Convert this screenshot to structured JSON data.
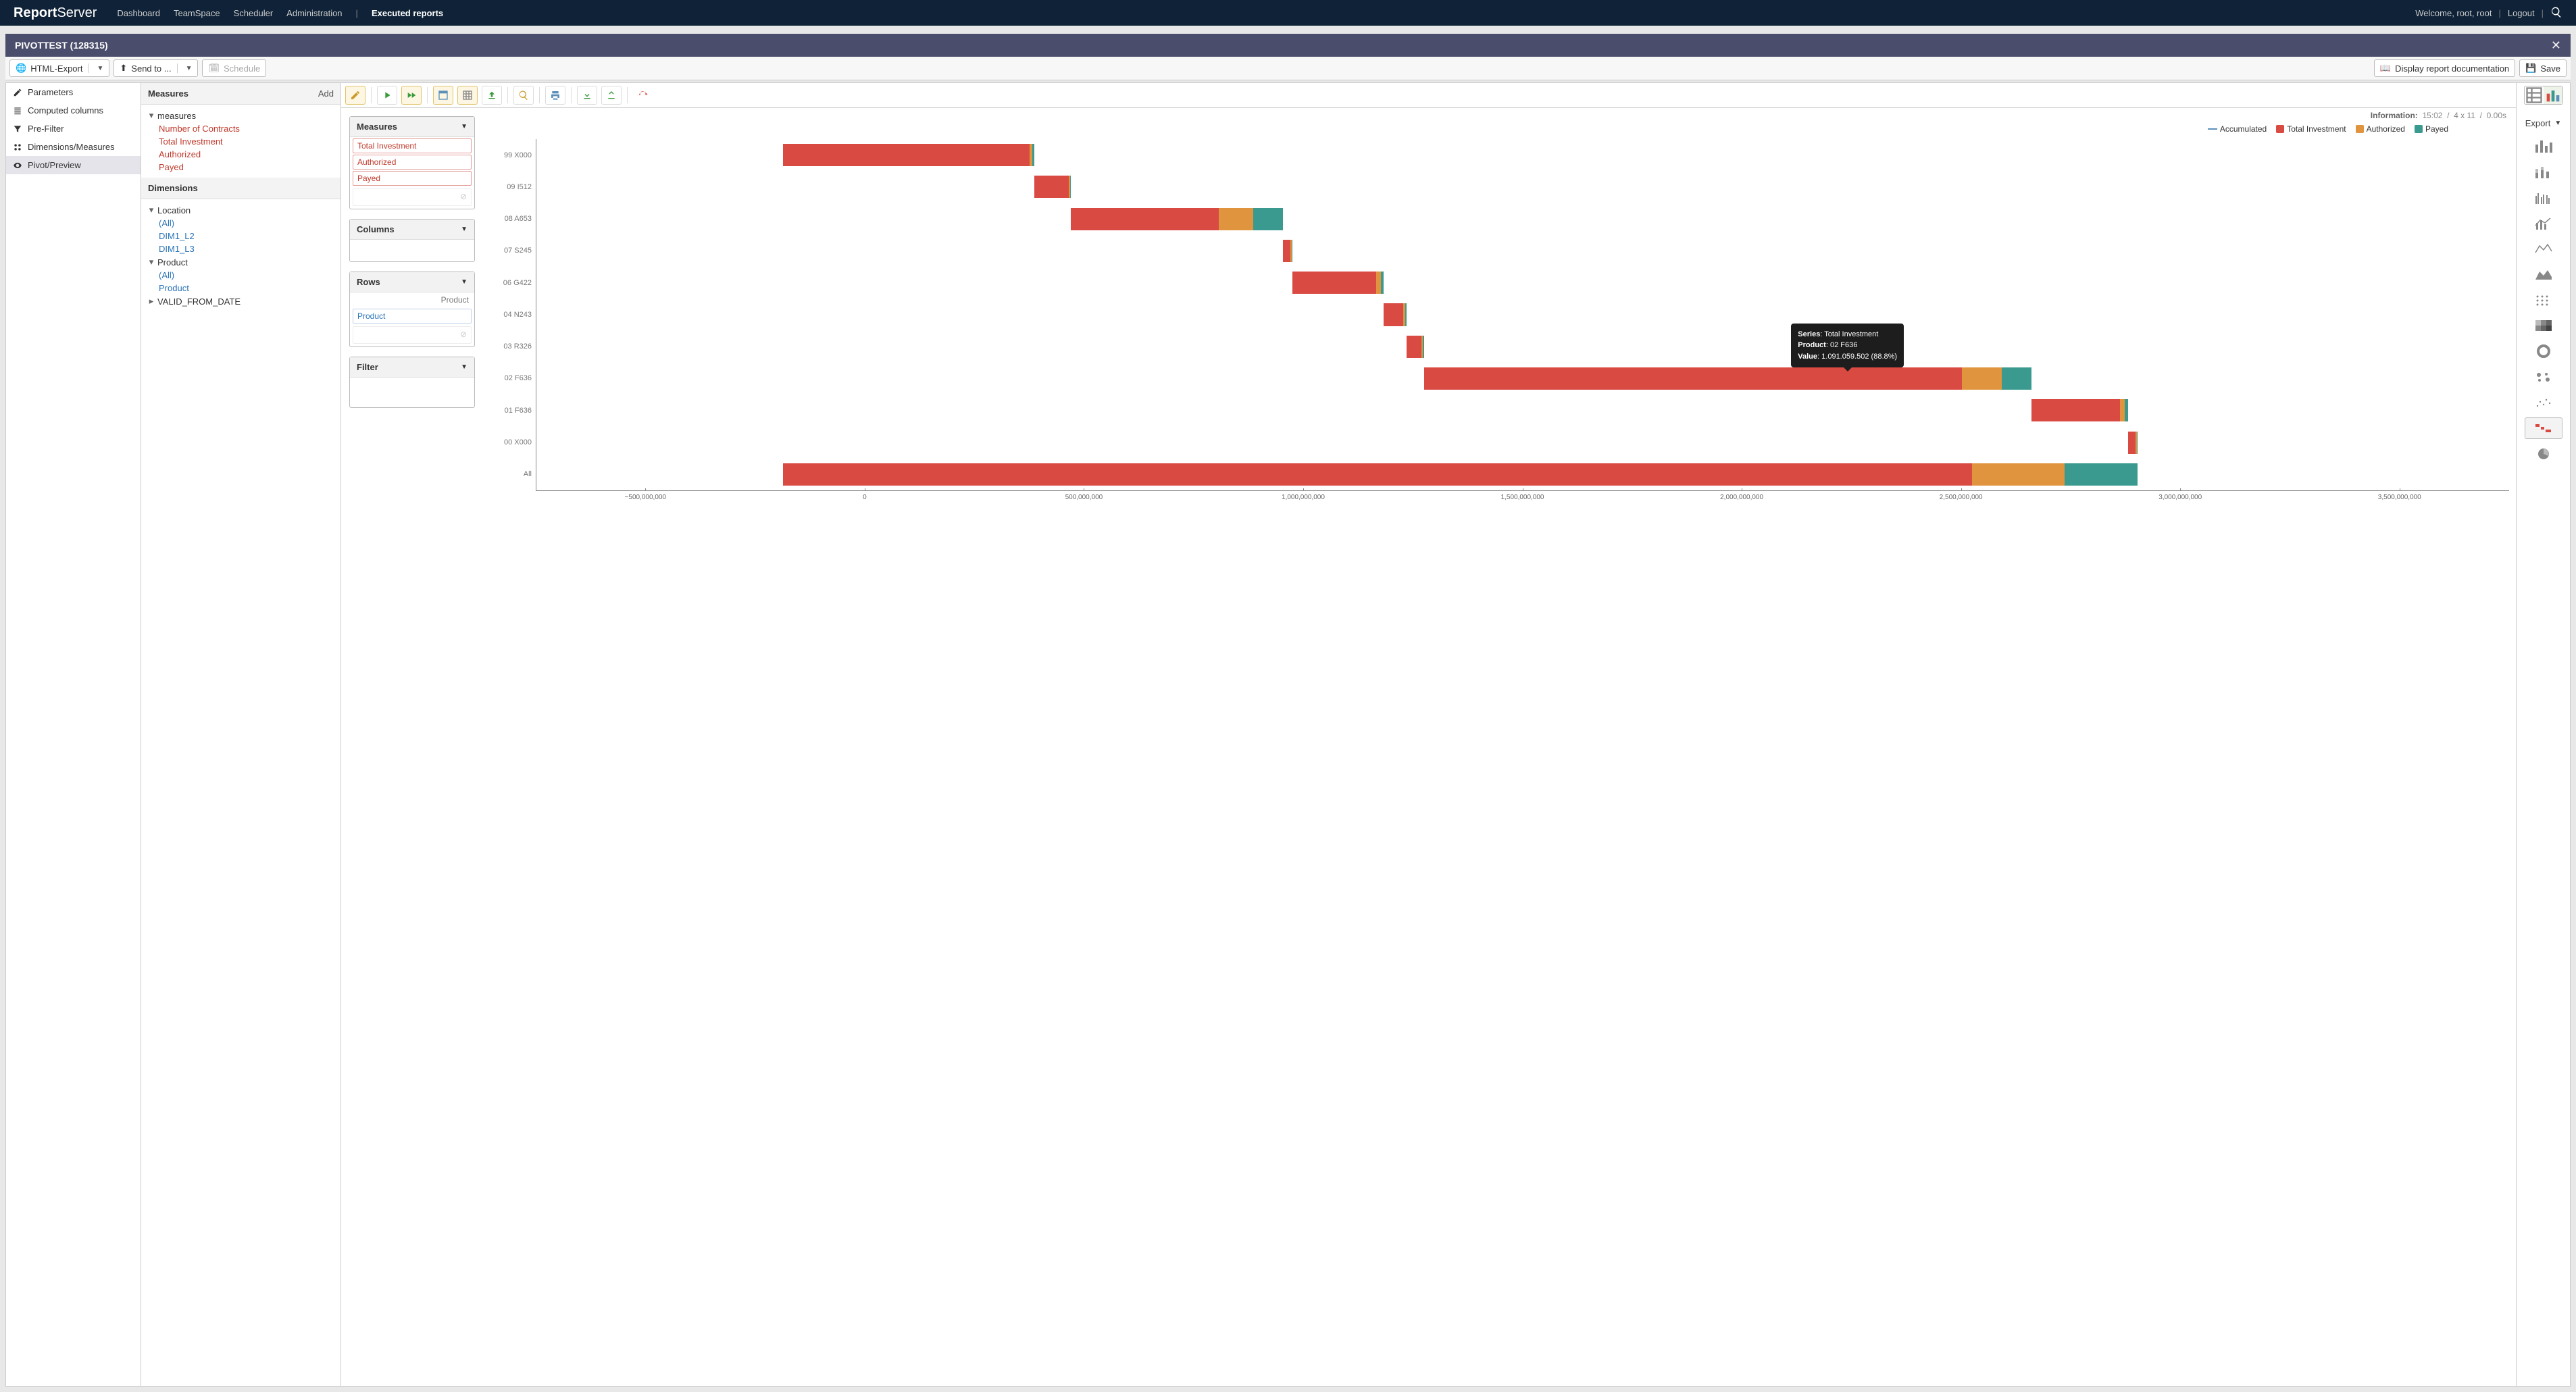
{
  "brand": {
    "bold": "Report",
    "light": "Server"
  },
  "topnav": {
    "dashboard": "Dashboard",
    "teamspace": "TeamSpace",
    "scheduler": "Scheduler",
    "admin": "Administration",
    "executed": "Executed reports"
  },
  "topright": {
    "welcome": "Welcome, root, root",
    "logout": "Logout"
  },
  "subbar": {
    "title": "PIVOTTEST (128315)"
  },
  "toolbar": {
    "html_export": "HTML-Export",
    "send_to": "Send to ...",
    "schedule": "Schedule",
    "display_doc": "Display report documentation",
    "save": "Save"
  },
  "leftnav": {
    "parameters": "Parameters",
    "computed": "Computed columns",
    "prefilter": "Pre-Filter",
    "dims": "Dimensions/Measures",
    "pivot": "Pivot/Preview"
  },
  "measures": {
    "hdr": "Measures",
    "add": "Add",
    "root": "measures",
    "items": [
      "Number of Contracts",
      "Total Investment",
      "Authorized",
      "Payed"
    ]
  },
  "dimensions": {
    "hdr": "Dimensions",
    "location": "Location",
    "loc_all": "(All)",
    "dim1l2": "DIM1_L2",
    "dim1l3": "DIM1_L3",
    "product": "Product",
    "prod_all": "(All)",
    "prod_item": "Product",
    "valid_from": "VALID_FROM_DATE"
  },
  "drop": {
    "measures": "Measures",
    "columns": "Columns",
    "rows": "Rows",
    "filter": "Filter",
    "rows_sub": "Product",
    "rows_chip": "Product",
    "m1": "Total Investment",
    "m2": "Authorized",
    "m3": "Payed"
  },
  "info": {
    "label": "Information:",
    "time": "15:02",
    "dims": "4 x 11",
    "dur": "0.00s"
  },
  "legend": {
    "acc": "Accumulated",
    "ti": "Total Investment",
    "auth": "Authorized",
    "payed": "Payed"
  },
  "colors": {
    "ti": "#d94a43",
    "auth": "#e0943d",
    "payed": "#3a9a8f",
    "acc": "#5b8fb9"
  },
  "tooltip": {
    "l1k": "Series",
    "l1v": "Total Investment",
    "l2k": "Product",
    "l2v": "02 F636",
    "l3k": "Value",
    "l3v": "1.091.059.502 (88.8%)"
  },
  "export_lbl": "Export",
  "chart_data": {
    "type": "bar",
    "orientation": "horizontal-waterfall",
    "xlabel": "",
    "ylabel": "",
    "categories": [
      "99 X000",
      "09 I512",
      "08 A653",
      "07 S245",
      "06 G422",
      "04 N243",
      "03 R326",
      "02 F636",
      "01 F636",
      "00 X000",
      "All"
    ],
    "x_ticks": [
      -500000000,
      0,
      500000000,
      1000000000,
      1500000000,
      2000000000,
      2500000000,
      3000000000,
      3500000000
    ],
    "x_tick_labels": [
      "−500,000,000",
      "0",
      "500,000,000",
      "1,000,000,000",
      "1,500,000,000",
      "2,000,000,000",
      "2,500,000,000",
      "3,000,000,000",
      "3,500,000,000"
    ],
    "series": [
      {
        "name": "Total Investment",
        "color": "#d94a43"
      },
      {
        "name": "Authorized",
        "color": "#e0943d"
      },
      {
        "name": "Payed",
        "color": "#3a9a8f"
      }
    ],
    "rows": [
      {
        "cat": "99 X000",
        "start": 0,
        "ti": 500000000,
        "auth": 5000000,
        "payed": 5000000
      },
      {
        "cat": "09 I512",
        "start": 510000000,
        "ti": 70000000,
        "auth": 2000000,
        "payed": 2000000
      },
      {
        "cat": "08 A653",
        "start": 584000000,
        "ti": 300000000,
        "auth": 70000000,
        "payed": 60000000
      },
      {
        "cat": "07 S245",
        "start": 1014000000,
        "ti": 15000000,
        "auth": 2000000,
        "payed": 2000000
      },
      {
        "cat": "06 G422",
        "start": 1033000000,
        "ti": 170000000,
        "auth": 10000000,
        "payed": 5000000
      },
      {
        "cat": "04 N243",
        "start": 1218000000,
        "ti": 40000000,
        "auth": 3000000,
        "payed": 3000000
      },
      {
        "cat": "03 R326",
        "start": 1264000000,
        "ti": 30000000,
        "auth": 3000000,
        "payed": 3000000
      },
      {
        "cat": "02 F636",
        "start": 1300000000,
        "ti": 1091059502,
        "auth": 80000000,
        "payed": 60000000
      },
      {
        "cat": "01 F636",
        "start": 2531000000,
        "ti": 180000000,
        "auth": 10000000,
        "payed": 7000000
      },
      {
        "cat": "00 X000",
        "start": 2728000000,
        "ti": 15000000,
        "auth": 2000000,
        "payed": 2000000
      },
      {
        "cat": "All",
        "start": 0,
        "ti": 2411000000,
        "auth": 187000000,
        "payed": 149000000
      }
    ],
    "x_min": -500000000,
    "x_max": 3500000000
  }
}
